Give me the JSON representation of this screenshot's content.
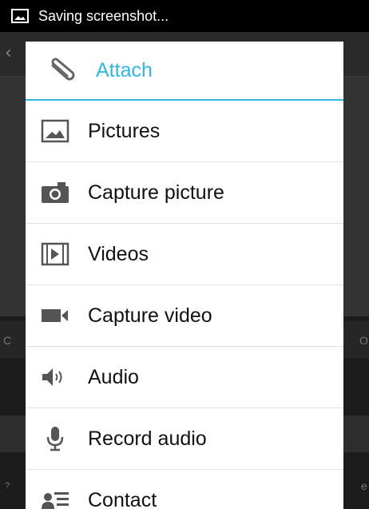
{
  "status_bar": {
    "text": "Saving screenshot..."
  },
  "background": {
    "left_letter_1": "C",
    "right_letter_1": "O",
    "left_letter_2": "?",
    "right_letter_2": "e"
  },
  "dialog": {
    "title": "Attach",
    "accent": "#33b5e5",
    "items": [
      {
        "label": "Pictures",
        "icon": "picture-icon"
      },
      {
        "label": "Capture picture",
        "icon": "camera-icon"
      },
      {
        "label": "Videos",
        "icon": "video-icon"
      },
      {
        "label": "Capture video",
        "icon": "video-camera-icon"
      },
      {
        "label": "Audio",
        "icon": "speaker-icon"
      },
      {
        "label": "Record audio",
        "icon": "microphone-icon"
      },
      {
        "label": "Contact",
        "icon": "contact-icon"
      }
    ]
  }
}
